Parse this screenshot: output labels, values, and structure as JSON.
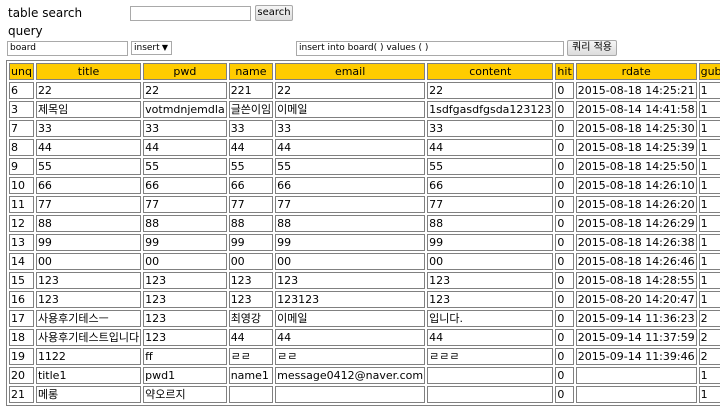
{
  "search": {
    "label": "table search",
    "value": "",
    "button": "search"
  },
  "query": {
    "label": "query",
    "table_value": "board",
    "mode": "insert",
    "sql_value": "insert into board( ) values ( )",
    "apply_button": "쿼리 적용"
  },
  "table": {
    "headers": [
      "unq",
      "title",
      "pwd",
      "name",
      "email",
      "content",
      "hit",
      "rdate",
      "gubun"
    ],
    "rows": [
      [
        "6",
        "22",
        "22",
        "221",
        "22",
        "22",
        "0",
        "2015-08-18 14:25:21",
        "1"
      ],
      [
        "3",
        "제목임",
        "votmdnjemdla",
        "글쓴이임",
        "이메일",
        "1sdfgasdfgsda123123",
        "0",
        "2015-08-14 14:41:58",
        "1"
      ],
      [
        "7",
        "33",
        "33",
        "33",
        "33",
        "33",
        "0",
        "2015-08-18 14:25:30",
        "1"
      ],
      [
        "8",
        "44",
        "44",
        "44",
        "44",
        "44",
        "0",
        "2015-08-18 14:25:39",
        "1"
      ],
      [
        "9",
        "55",
        "55",
        "55",
        "55",
        "55",
        "0",
        "2015-08-18 14:25:50",
        "1"
      ],
      [
        "10",
        "66",
        "66",
        "66",
        "66",
        "66",
        "0",
        "2015-08-18 14:26:10",
        "1"
      ],
      [
        "11",
        "77",
        "77",
        "77",
        "77",
        "77",
        "0",
        "2015-08-18 14:26:20",
        "1"
      ],
      [
        "12",
        "88",
        "88",
        "88",
        "88",
        "88",
        "0",
        "2015-08-18 14:26:29",
        "1"
      ],
      [
        "13",
        "99",
        "99",
        "99",
        "99",
        "99",
        "0",
        "2015-08-18 14:26:38",
        "1"
      ],
      [
        "14",
        "00",
        "00",
        "00",
        "00",
        "00",
        "0",
        "2015-08-18 14:26:46",
        "1"
      ],
      [
        "15",
        "123",
        "123",
        "123",
        "123",
        "123",
        "0",
        "2015-08-18 14:28:55",
        "1"
      ],
      [
        "16",
        "123",
        "123",
        "123",
        "123123",
        "123",
        "0",
        "2015-08-20 14:20:47",
        "1"
      ],
      [
        "17",
        "사용후기테스ㅡ",
        "123",
        "최영강",
        "이메일",
        "입니다.",
        "0",
        "2015-09-14 11:36:23",
        "2"
      ],
      [
        "18",
        "사용후기테스트입니다",
        "123",
        "44",
        "44",
        "44",
        "0",
        "2015-09-14 11:37:59",
        "2"
      ],
      [
        "19",
        "1122",
        "ff",
        "ㄹㄹ",
        "ㄹㄹ",
        "ㄹㄹㄹ",
        "0",
        "2015-09-14 11:39:46",
        "2"
      ],
      [
        "20",
        "title1",
        "pwd1",
        "name1",
        "message0412@naver.com",
        "",
        "0",
        "",
        "1"
      ],
      [
        "21",
        "메롱",
        "약오르지",
        "",
        "",
        "",
        "0",
        "",
        "1"
      ]
    ]
  }
}
